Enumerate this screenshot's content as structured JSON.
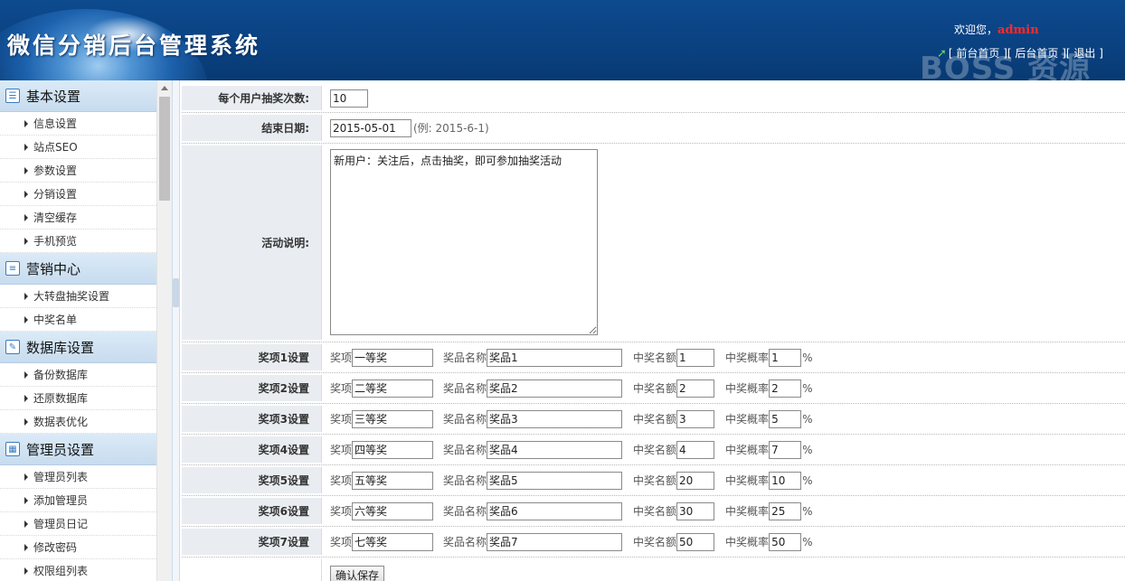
{
  "header": {
    "title": "微信分销后台管理系统",
    "welcome_text": "欢迎您，",
    "username": "admin",
    "links": [
      "[ 前台首页 ]",
      "[ 后台首页 ]",
      "[ 退出 ]"
    ],
    "watermark": "BOSS 资源"
  },
  "sidebar": {
    "sections": [
      {
        "title": "基本设置",
        "icon": "list-icon",
        "items": [
          "信息设置",
          "站点SEO",
          "参数设置",
          "分销设置",
          "清空缓存",
          "手机预览"
        ]
      },
      {
        "title": "营销中心",
        "icon": "chat-icon",
        "items": [
          "大转盘抽奖设置",
          "中奖名单"
        ]
      },
      {
        "title": "数据库设置",
        "icon": "edit-icon",
        "items": [
          "备份数据库",
          "还原数据库",
          "数据表优化"
        ]
      },
      {
        "title": "管理员设置",
        "icon": "calendar-icon",
        "items": [
          "管理员列表",
          "添加管理员",
          "管理员日记",
          "修改密码",
          "权限组列表"
        ]
      }
    ]
  },
  "form": {
    "draw_count": {
      "label": "每个用户抽奖次数:",
      "value": "10"
    },
    "end_date": {
      "label": "结束日期:",
      "value": "2015-05-01",
      "hint": "(例: 2015-6-1)"
    },
    "description": {
      "label": "活动说明:",
      "value": "新用户：关注后，点击抽奖，即可参加抽奖活动"
    },
    "field_labels": {
      "prize": "奖项",
      "prize_name": "奖品名称",
      "count": "中奖名额",
      "rate": "中奖概率",
      "percent": "%"
    },
    "prizes": [
      {
        "label": "奖项1设置",
        "prize": "一等奖",
        "name": "奖品1",
        "count": "1",
        "rate": "1"
      },
      {
        "label": "奖项2设置",
        "prize": "二等奖",
        "name": "奖品2",
        "count": "2",
        "rate": "2"
      },
      {
        "label": "奖项3设置",
        "prize": "三等奖",
        "name": "奖品3",
        "count": "3",
        "rate": "5"
      },
      {
        "label": "奖项4设置",
        "prize": "四等奖",
        "name": "奖品4",
        "count": "4",
        "rate": "7"
      },
      {
        "label": "奖项5设置",
        "prize": "五等奖",
        "name": "奖品5",
        "count": "20",
        "rate": "10"
      },
      {
        "label": "奖项6设置",
        "prize": "六等奖",
        "name": "奖品6",
        "count": "30",
        "rate": "25"
      },
      {
        "label": "奖项7设置",
        "prize": "七等奖",
        "name": "奖品7",
        "count": "50",
        "rate": "50"
      }
    ],
    "submit_label": "确认保存"
  }
}
